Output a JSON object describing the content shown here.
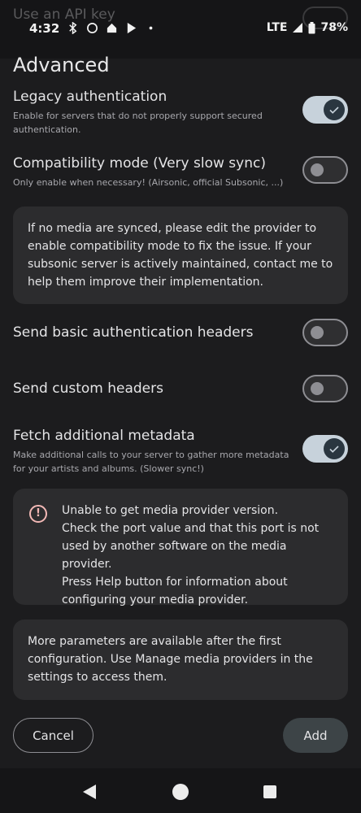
{
  "status_bar": {
    "time": "4:32",
    "network": "LTE",
    "battery": "78%"
  },
  "peek": {
    "label": "Use an API key"
  },
  "section": {
    "title": "Advanced"
  },
  "settings": {
    "legacy_auth": {
      "title": "Legacy authentication",
      "subtitle": "Enable for servers that do not properly support secured authentication.",
      "enabled": true
    },
    "compat_mode": {
      "title": "Compatibility mode (Very slow sync)",
      "subtitle": "Only enable when necessary! (Airsonic, official Subsonic, ...)",
      "enabled": false
    },
    "basic_auth_headers": {
      "title": "Send basic authentication headers",
      "enabled": false
    },
    "custom_headers": {
      "title": "Send custom headers",
      "enabled": false
    },
    "fetch_metadata": {
      "title": "Fetch additional metadata",
      "subtitle": "Make additional calls to your server to gather more metadata for your artists and albums. (Slower sync!)",
      "enabled": true
    }
  },
  "cards": {
    "compat_info": "If no media are synced, please edit the provider to enable compatibility mode to fix the issue. If your subsonic server is actively maintained, contact me to help them improve their implementation.",
    "error": "Unable to get media provider version.\nCheck the port value and that this port is not used by another software on the media provider.\nPress Help button for information about configuring your media provider.",
    "more_params": "More parameters are available after the first configuration. Use Manage media providers in the settings to access them."
  },
  "buttons": {
    "cancel": "Cancel",
    "add": "Add"
  },
  "icons": {
    "error": "error-outline-icon",
    "check": "check-icon",
    "back": "nav-back-icon",
    "home": "nav-home-icon",
    "recents": "nav-recents-icon"
  },
  "colors": {
    "background": "#1c1c1e",
    "card": "#2c2c2e",
    "toggle_on": "#c7d2db",
    "error": "#f2b8b5"
  }
}
